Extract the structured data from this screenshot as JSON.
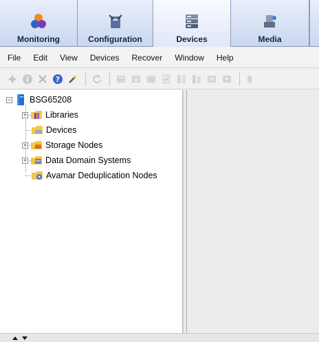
{
  "nav": {
    "tabs": [
      {
        "label": "Monitoring",
        "icon": "monitoring-icon"
      },
      {
        "label": "Configuration",
        "icon": "configuration-icon"
      },
      {
        "label": "Devices",
        "icon": "devices-icon",
        "active": true
      },
      {
        "label": "Media",
        "icon": "media-icon"
      }
    ]
  },
  "menu": {
    "items": [
      "File",
      "Edit",
      "View",
      "Devices",
      "Recover",
      "Window",
      "Help"
    ]
  },
  "toolbar": {
    "icons": [
      "add-icon",
      "info-icon",
      "delete-icon",
      "help-icon",
      "wizard-icon",
      "refresh-icon",
      "library-op-icon",
      "mount-icon",
      "unmount-icon",
      "label-icon",
      "inventory-icon",
      "reset-icon",
      "slot-icon",
      "eject-icon",
      "more-icon"
    ]
  },
  "tree": {
    "root": {
      "label": "BSG65208",
      "icon": "server-icon"
    },
    "children": [
      {
        "label": "Libraries",
        "icon": "libraries-icon",
        "expandable": true
      },
      {
        "label": "Devices",
        "icon": "devices-folder-icon",
        "expandable": false
      },
      {
        "label": "Storage Nodes",
        "icon": "storage-nodes-icon",
        "expandable": true
      },
      {
        "label": "Data Domain Systems",
        "icon": "data-domain-icon",
        "expandable": true
      },
      {
        "label": "Avamar Deduplication Nodes",
        "icon": "avamar-icon",
        "expandable": false
      }
    ]
  },
  "colors": {
    "nav_bg": "#cbd7ee",
    "folder": "#f2c84b",
    "server": "#1f6fd1"
  }
}
